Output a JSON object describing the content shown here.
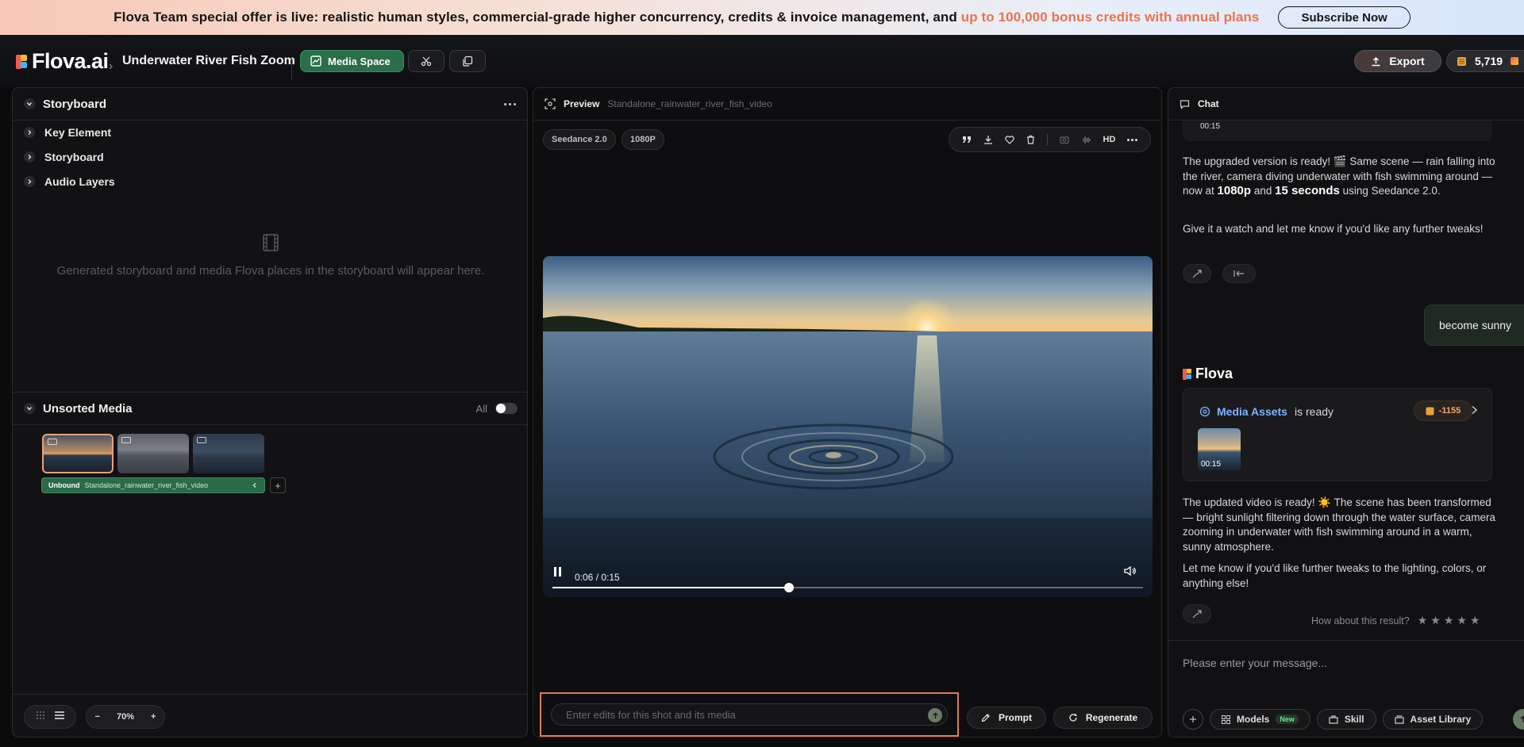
{
  "banner": {
    "text_main": "Flova Team special offer is live: realistic human styles, commercial-grade higher concurrency, credits & invoice management, and ",
    "text_highlight": "up to 100,000 bonus credits with annual plans",
    "subscribe_label": "Subscribe Now"
  },
  "topbar": {
    "logo": "Flova.ai",
    "breadcrumb_sep": "›",
    "project_title": "Underwater River Fish Zoom",
    "media_space_label": "Media Space",
    "export_label": "Export",
    "credits": "5,719"
  },
  "storyboard": {
    "title": "Storyboard",
    "tree": [
      "Key Element",
      "Storyboard",
      "Audio Layers"
    ],
    "empty_text": "Generated storyboard and media Flova places in the storyboard will appear here."
  },
  "unsorted": {
    "title": "Unsorted Media",
    "toggle_label": "All",
    "bar_label": "Unbound",
    "bar_file": "Standalone_rainwater_river_fish_video",
    "plus": "+"
  },
  "left_footer": {
    "zoom_minus": "−",
    "zoom": "70%",
    "zoom_plus": "+"
  },
  "preview": {
    "title": "Preview",
    "filename": "Standalone_rainwater_river_fish_video",
    "chips": [
      "Seedance 2.0",
      "1080P"
    ],
    "hd_label": "HD",
    "time": "0:06 / 0:15",
    "progress_fraction": 0.4,
    "edit_placeholder": "Enter edits for this shot and its media",
    "prompt_label": "Prompt",
    "regenerate_label": "Regenerate"
  },
  "chat": {
    "title": "Chat",
    "top_thumb_time": "00:15",
    "msg1_a": "The upgraded version is ready! 🎬 Same scene — rain falling into the river, camera diving underwater with fish swimming around — now at ",
    "msg1_b": "1080p",
    "msg1_c": " and ",
    "msg1_d": "15 seconds",
    "msg1_e": " using Seedance 2.0.",
    "msg2": "Give it a watch and let me know if you'd like any further tweaks!",
    "user_msg": "become sunny",
    "bot_name": "Flova",
    "assets_label": "Media Assets",
    "assets_ready": "is ready",
    "cost": "-1155",
    "card_thumb_time": "00:15",
    "msg3": "The updated video is ready! ☀️ The scene has been transformed — bright sunlight filtering down through the water surface, camera zooming in underwater with fish swimming around in a warm, sunny atmosphere.",
    "msg4": "Let me know if you'd like further tweaks to the lighting, colors, or anything else!",
    "rating_label": "How about this result?",
    "input_placeholder": "Please enter your message...",
    "models_label": "Models",
    "new_badge": "New",
    "skill_label": "Skill",
    "asset_library_label": "Asset Library"
  },
  "colors": {
    "accent_green": "#2b6e4a",
    "highlight_orange": "#e8744f",
    "edit_border": "#e07a52",
    "link_blue": "#7fb4ff"
  }
}
